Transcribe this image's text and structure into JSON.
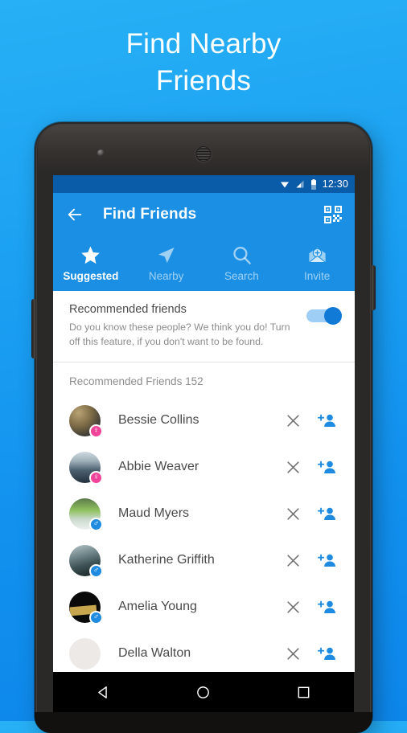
{
  "promo": {
    "line1": "Find Nearby",
    "line2": "Friends"
  },
  "colors": {
    "background_top": "#27b0f5",
    "background_bottom": "#0d86ea",
    "statusbar": "#0b5ca8",
    "appbar": "#1a8fe3",
    "accent": "#1e8ae0",
    "female_badge": "#f2439a",
    "male_badge": "#1e8ae0",
    "text_primary": "#4a4a4a",
    "text_secondary": "#8c8c8c"
  },
  "statusbar": {
    "time": "12:30",
    "icons": [
      "wifi-icon",
      "signal-icon",
      "battery-icon"
    ]
  },
  "appbar": {
    "back_icon": "back-arrow-icon",
    "title": "Find Friends",
    "qr_icon": "qr-code-icon"
  },
  "tabs": [
    {
      "label": "Suggested",
      "icon": "star-icon",
      "active": true
    },
    {
      "label": "Nearby",
      "icon": "navigate-icon",
      "active": false
    },
    {
      "label": "Search",
      "icon": "search-icon",
      "active": false
    },
    {
      "label": "Invite",
      "icon": "envelope-plus-icon",
      "active": false
    }
  ],
  "recommended_card": {
    "title": "Recommended friends",
    "description": "Do you know these people? We think you do! Turn off this feature, if you don't want to be found.",
    "toggle_on": true
  },
  "section": {
    "header": "Recommended Friends 152"
  },
  "friends": [
    {
      "name": "Bessie Collins",
      "gender": "f",
      "gender_glyph": "♀",
      "dismiss_icon": "close-icon",
      "add_icon": "add-person-icon"
    },
    {
      "name": "Abbie Weaver",
      "gender": "f",
      "gender_glyph": "♀",
      "dismiss_icon": "close-icon",
      "add_icon": "add-person-icon"
    },
    {
      "name": "Maud Myers",
      "gender": "m",
      "gender_glyph": "♂",
      "dismiss_icon": "close-icon",
      "add_icon": "add-person-icon"
    },
    {
      "name": "Katherine Griffith",
      "gender": "m",
      "gender_glyph": "♂",
      "dismiss_icon": "close-icon",
      "add_icon": "add-person-icon"
    },
    {
      "name": "Amelia Young",
      "gender": "m",
      "gender_glyph": "♂",
      "dismiss_icon": "close-icon",
      "add_icon": "add-person-icon"
    },
    {
      "name": "Della Walton",
      "gender": "",
      "gender_glyph": "",
      "dismiss_icon": "close-icon",
      "add_icon": "add-person-icon"
    }
  ],
  "navbar": {
    "back": "nav-back-icon",
    "home": "nav-home-icon",
    "recents": "nav-recents-icon"
  }
}
